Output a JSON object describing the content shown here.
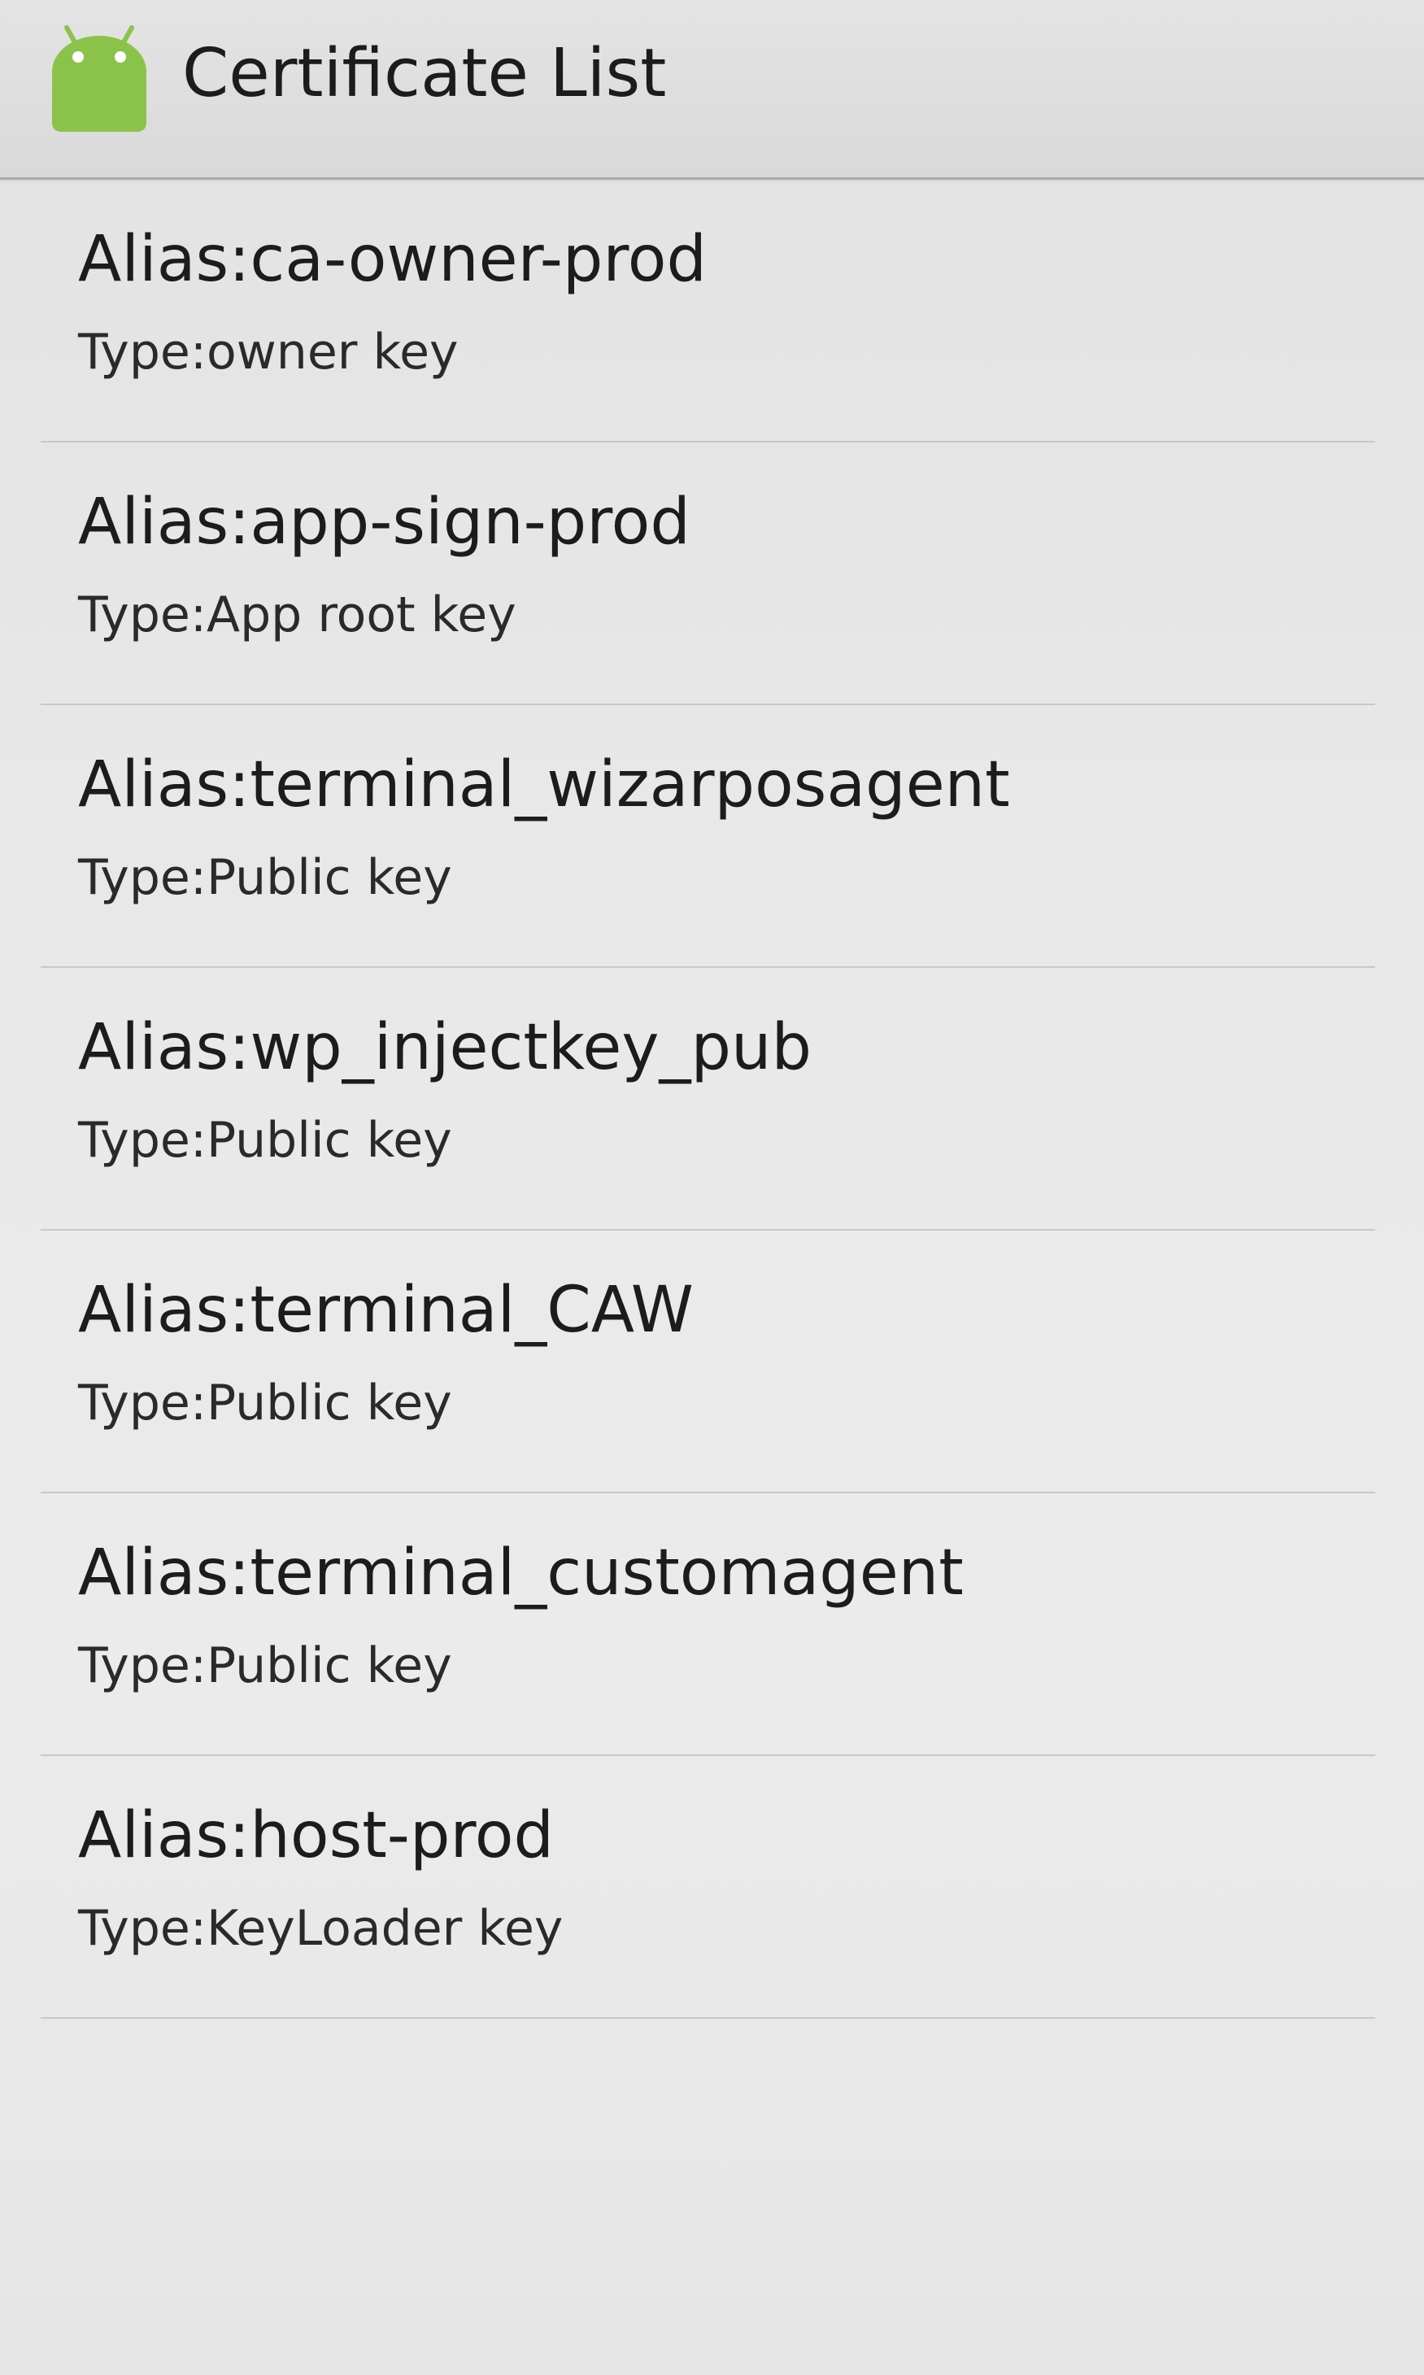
{
  "action_bar": {
    "title": "Certificate List",
    "icon": "android-robot-icon",
    "icon_color": "#8bc34a"
  },
  "certificates": [
    {
      "alias": "Alias:ca-owner-prod",
      "type": "Type:owner key"
    },
    {
      "alias": "Alias:app-sign-prod",
      "type": "Type:App root key"
    },
    {
      "alias": "Alias:terminal_wizarposagent",
      "type": "Type:Public key"
    },
    {
      "alias": "Alias:wp_injectkey_pub",
      "type": "Type:Public key"
    },
    {
      "alias": "Alias:terminal_CAW",
      "type": "Type:Public key"
    },
    {
      "alias": "Alias:terminal_customagent",
      "type": "Type:Public key"
    },
    {
      "alias": "Alias:host-prod",
      "type": "Type:KeyLoader key"
    }
  ]
}
